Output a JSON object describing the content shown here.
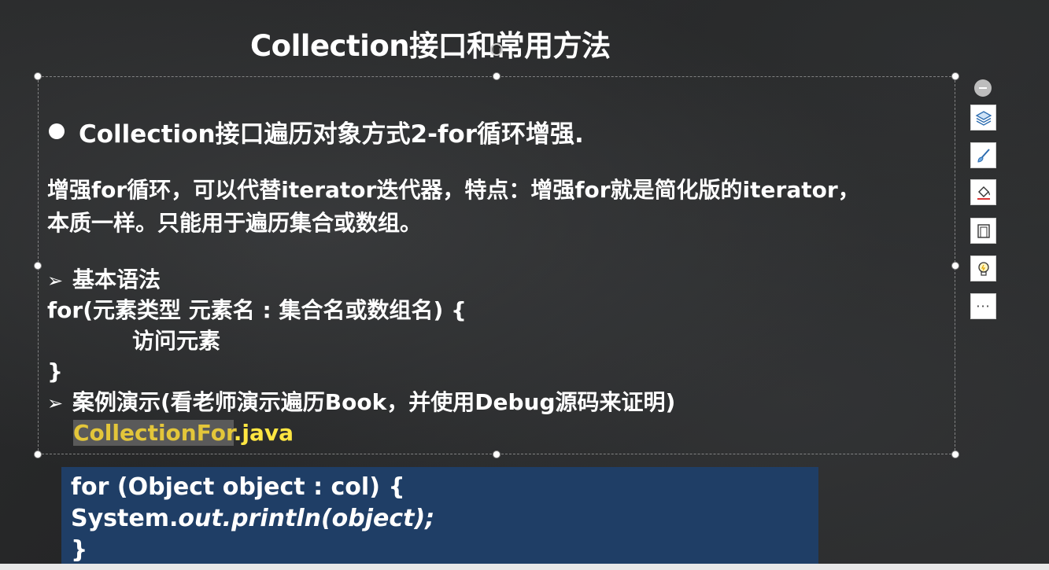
{
  "slide": {
    "title": "Collection接口和常用方法",
    "bullet_heading": "Collection接口遍历对象方式2-for循环增强.",
    "paragraph_line1": "增强for循环，可以代替iterator迭代器，特点：增强for就是简化版的iterator，",
    "paragraph_line2": "本质一样。只能用于遍历集合或数组。",
    "syntax_header_arrow": "➢",
    "syntax_header": "基本语法",
    "syntax_line1": "for(元素类型 元素名 : 集合名或数组名) {",
    "syntax_line2": "访问元素",
    "syntax_line3": "}",
    "demo_arrow": "➢",
    "demo_line": "案例演示(看老师演示遍历Book，并使用Debug源码来证明)",
    "demo_file_name": "CollectionFor",
    "demo_file_ext": ".java"
  },
  "code": {
    "line1": "for (Object object : col) {",
    "line2_prefix": "System.",
    "line2_italic": "out.println(object);",
    "line3": "}"
  },
  "toolbar": {
    "collapse_icon": "minus-circle-icon",
    "layers_icon": "layers-icon",
    "brush_icon": "paintbrush-icon",
    "fill_icon": "paint-bucket-icon",
    "frame_icon": "frame-icon",
    "idea_icon": "lightbulb-icon",
    "more_label": "···"
  },
  "colors": {
    "code_background": "#1f3e66",
    "file_highlight": "#e3c63a",
    "file_ext": "#ffe642"
  }
}
